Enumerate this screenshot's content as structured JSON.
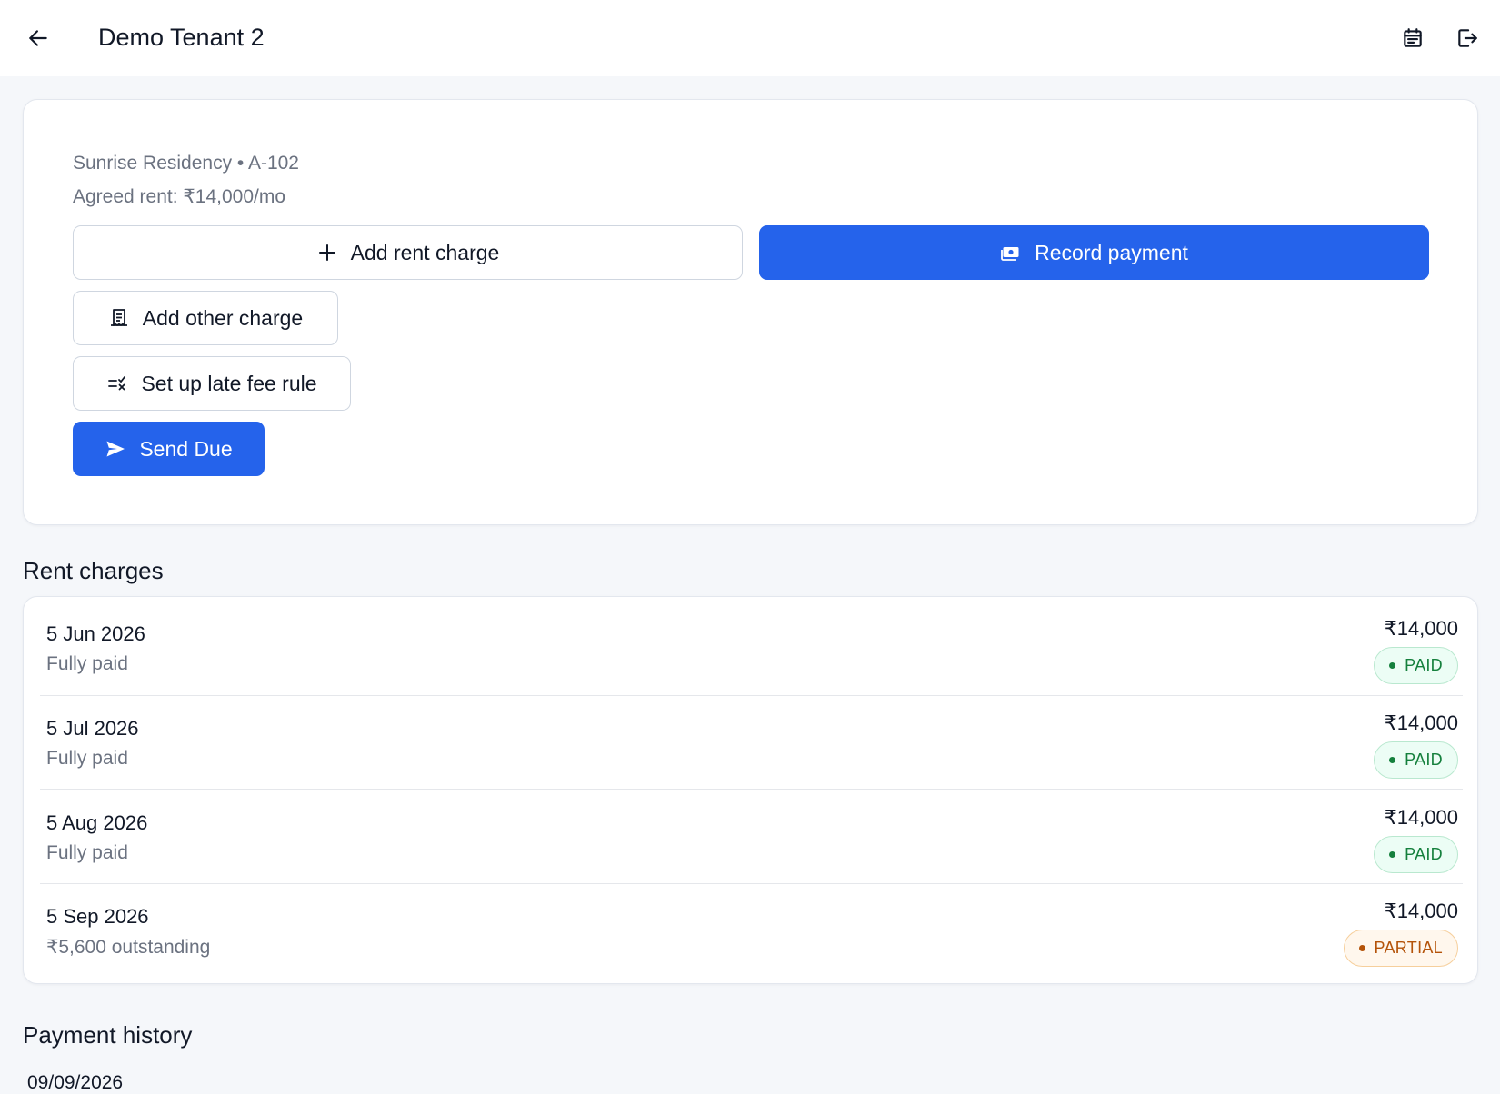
{
  "appbar": {
    "title": "Demo Tenant 2",
    "back_icon": "arrow-left-icon",
    "calendar_icon": "calendar-icon",
    "logout_icon": "logout-icon"
  },
  "tenant": {
    "property_line": "Sunrise Residency • A-102",
    "rent_line": "Agreed rent: ₹14,000/mo"
  },
  "actions": {
    "add_rent_charge": "Add rent charge",
    "record_payment": "Record payment",
    "add_other_charge": "Add other charge",
    "late_fee_rule": "Set up late fee rule",
    "send_due": "Send Due"
  },
  "colors": {
    "primary": "#2563eb",
    "paid": "#15803d",
    "partial": "#b45309"
  },
  "rent_charges": {
    "title": "Rent charges",
    "items": [
      {
        "date": "5 Jun 2026",
        "status_text": "Fully paid",
        "amount": "₹14,000",
        "badge": "PAID",
        "badge_type": "paid"
      },
      {
        "date": "5 Jul 2026",
        "status_text": "Fully paid",
        "amount": "₹14,000",
        "badge": "PAID",
        "badge_type": "paid"
      },
      {
        "date": "5 Aug 2026",
        "status_text": "Fully paid",
        "amount": "₹14,000",
        "badge": "PAID",
        "badge_type": "paid"
      },
      {
        "date": "5 Sep 2026",
        "status_text": "₹5,600 outstanding",
        "amount": "₹14,000",
        "badge": "PARTIAL",
        "badge_type": "partial"
      }
    ]
  },
  "payment_history": {
    "title": "Payment history",
    "first_date": "09/09/2026"
  }
}
